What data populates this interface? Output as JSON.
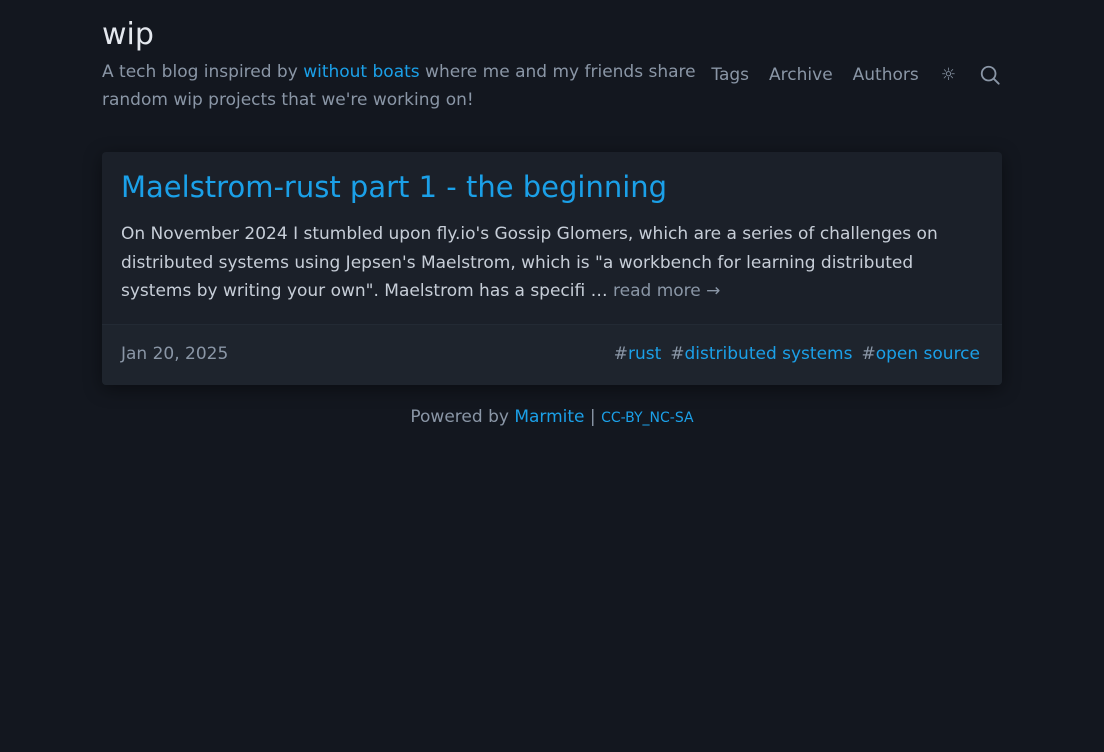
{
  "site": {
    "title": "wip",
    "tagline_prefix": "A tech blog inspired by ",
    "tagline_link": "without boats",
    "tagline_suffix": " where me and my friends share random wip projects that we're working on!"
  },
  "nav": {
    "items": [
      {
        "label": "Tags"
      },
      {
        "label": "Archive"
      },
      {
        "label": "Authors"
      }
    ],
    "theme_toggle": "☼",
    "search_icon": "search-icon"
  },
  "post": {
    "title": "Maelstrom-rust part 1 - the beginning",
    "excerpt": "On November 2024 I stumbled upon fly.io's Gossip Glomers, which are a series of challenges on distributed systems using Jepsen's Maelstrom, which is \"a workbench for learning distributed systems by writing your own\". Maelstrom has a specifi … ",
    "read_more": "read more →",
    "date": "Jan 20, 2025",
    "tags": [
      {
        "hash": "#",
        "label": "rust"
      },
      {
        "hash": "#",
        "label": "distributed systems"
      },
      {
        "hash": "#",
        "label": "open source"
      }
    ]
  },
  "footer": {
    "powered_by": "Powered by ",
    "engine": "Marmite",
    "separator": " | ",
    "license": "CC-BY_NC-SA"
  },
  "colors": {
    "background": "#13171f",
    "card": "#1b2029",
    "accent": "#1ba0e8",
    "muted": "#8a96a6",
    "text": "#c7ced8"
  }
}
